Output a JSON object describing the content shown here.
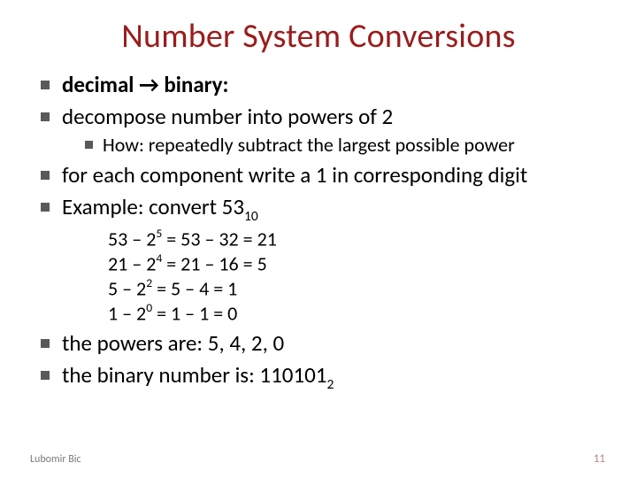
{
  "title": "Number System Conversions",
  "b1_pre": "decimal ",
  "b1_arrow": "→",
  "b1_post": " binary:",
  "b2": "decompose number into powers of 2",
  "b2_sub": "How: repeatedly subtract the largest possible power",
  "b3": "for each component write a 1 in corresponding digit",
  "b4_pre": "Example: convert 53",
  "b4_sub": "10",
  "calc1_a": "53 – 2",
  "calc1_exp": "5",
  "calc1_b": " = 53 – 32 = 21",
  "calc2_a": "21 – 2",
  "calc2_exp": "4",
  "calc2_b": " = 21 – 16 = 5",
  "calc3_a": "5 – 2",
  "calc3_exp": "2",
  "calc3_b": " = 5 – 4 = 1",
  "calc4_a": "1 – 2",
  "calc4_exp": "0",
  "calc4_b": " = 1 – 1 = 0",
  "b5": "the powers are: 5, 4, 2, 0",
  "b6_pre": "the binary number is: 110101",
  "b6_sub": "2",
  "footer_author": "Lubomir Bic",
  "footer_page": "11"
}
